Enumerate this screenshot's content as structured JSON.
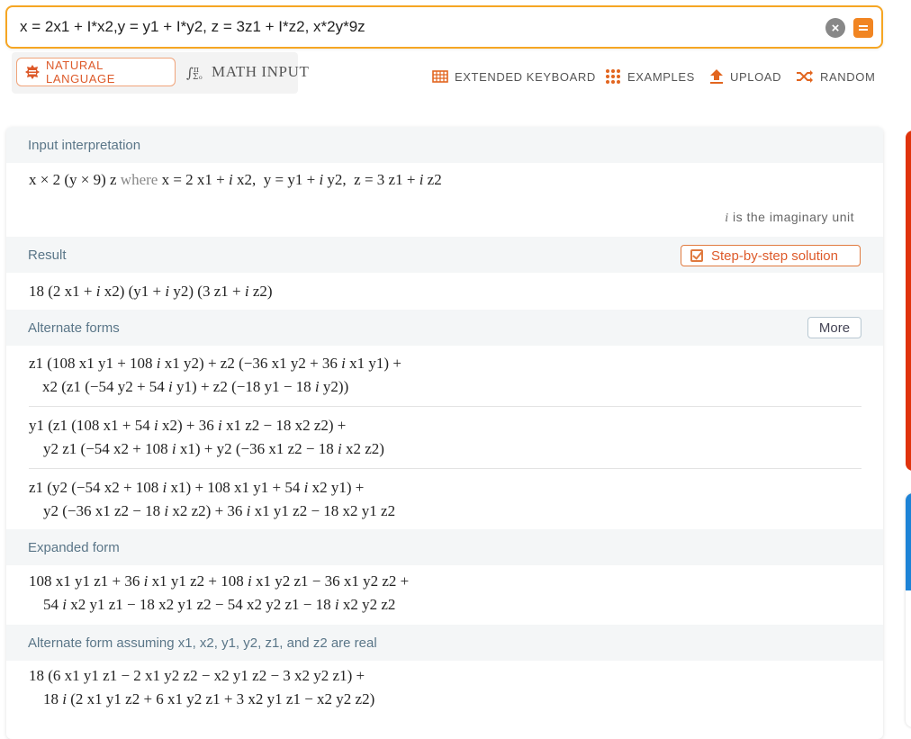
{
  "search": {
    "query": "x = 2x1 + I*x2,y = y1 + I*y2, z = 3z1 + I*z2, x*2y*9z",
    "clear_label": "×"
  },
  "modes": {
    "natural_label": "NATURAL LANGUAGE",
    "math_label": "MATH INPUT"
  },
  "toolbar": {
    "keyboard_label": "EXTENDED KEYBOARD",
    "examples_label": "EXAMPLES",
    "upload_label": "UPLOAD",
    "random_label": "RANDOM"
  },
  "colors": {
    "accent": "#f18522",
    "pod_title": "#5a7688",
    "side_red": "#e0330c",
    "side_blue": "#1d83d6"
  },
  "pods": {
    "input": {
      "title": "Input interpretation",
      "expr": "x × 2 (y × 9) z",
      "where": "where",
      "defs": "x = 2 x1 + i x2,  y = y1 + i y2,  z = 3 z1 + i z2",
      "note_i": "i",
      "note_text": " is the imaginary unit"
    },
    "result": {
      "title": "Result",
      "step_label": "Step-by-step solution",
      "expr": "18 (2 x1 + i x2) (y1 + i y2) (3 z1 + i z2)"
    },
    "alternate": {
      "title": "Alternate forms",
      "more_label": "More",
      "forms": [
        [
          "z1 (108 x1 y1 + 108 i x1 y2) + z2 (−36 x1 y2 + 36 i x1 y1) +",
          "x2 (z1 (−54 y2 + 54 i y1) + z2 (−18 y1 − 18 i y2))"
        ],
        [
          "y1 (z1 (108 x1 + 54 i x2) + 36 i x1 z2 − 18 x2 z2) +",
          "y2 z1 (−54 x2 + 108 i x1) + y2 (−36 x1 z2 − 18 i x2 z2)"
        ],
        [
          "z1 (y2 (−54 x2 + 108 i x1) + 108 x1 y1 + 54 i x2 y1) +",
          "y2 (−36 x1 z2 − 18 i x2 z2) + 36 i x1 y1 z2 − 18 x2 y1 z2"
        ]
      ]
    },
    "expanded": {
      "title": "Expanded form",
      "lines": [
        "108 x1 y1 z1 + 36 i x1 y1 z2 + 108 i x1 y2 z1 − 36 x1 y2 z2 +",
        "54 i x2 y1 z1 − 18 x2 y1 z2 − 54 x2 y2 z1 − 18 i x2 y2 z2"
      ]
    },
    "real": {
      "title": "Alternate form assuming x1, x2, y1, y2, z1, and z2 are real",
      "lines": [
        "18 (6 x1 y1 z1 − 2 x1 y2 z2 − x2 y1 z2 − 3 x2 y2 z1) +",
        "18 i (2 x1 y1 z2 + 6 x1 y2 z1 + 3 x2 y1 z1 − x2 y2 z2)"
      ]
    }
  }
}
